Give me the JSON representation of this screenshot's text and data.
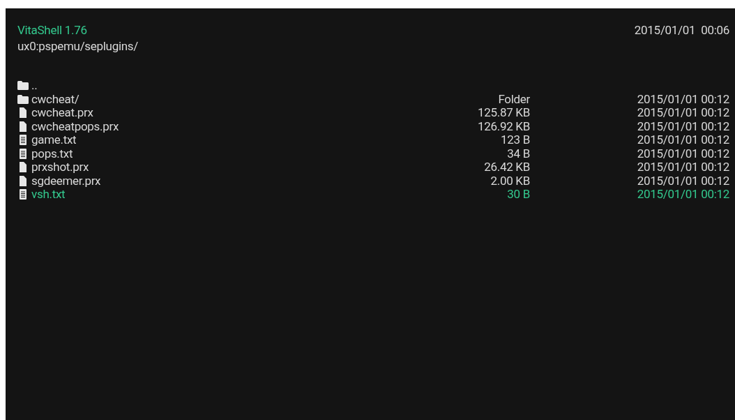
{
  "header": {
    "title": "VitaShell 1.76",
    "path": "ux0:pspemu/seplugins/",
    "clock": "2015/01/01  00:06"
  },
  "entries": [
    {
      "kind": "folder",
      "name": "..",
      "selected": false
    },
    {
      "kind": "folder",
      "name": "cwcheat/",
      "size": "Folder",
      "date": "2015/01/01 00:12",
      "selected": false
    },
    {
      "kind": "file",
      "name": "cwcheat.prx",
      "size": "125.87 KB",
      "date": "2015/01/01 00:12",
      "selected": false
    },
    {
      "kind": "file",
      "name": "cwcheatpops.prx",
      "size": "126.92 KB",
      "date": "2015/01/01 00:12",
      "selected": false
    },
    {
      "kind": "text",
      "name": "game.txt",
      "size": "123 B",
      "date": "2015/01/01 00:12",
      "selected": false
    },
    {
      "kind": "text",
      "name": "pops.txt",
      "size": "34 B",
      "date": "2015/01/01 00:12",
      "selected": false
    },
    {
      "kind": "file",
      "name": "prxshot.prx",
      "size": "26.42 KB",
      "date": "2015/01/01 00:12",
      "selected": false
    },
    {
      "kind": "file",
      "name": "sgdeemer.prx",
      "size": "2.00 KB",
      "date": "2015/01/01 00:12",
      "selected": false
    },
    {
      "kind": "text",
      "name": "vsh.txt",
      "size": "30 B",
      "date": "2015/01/01 00:12",
      "selected": true
    }
  ]
}
